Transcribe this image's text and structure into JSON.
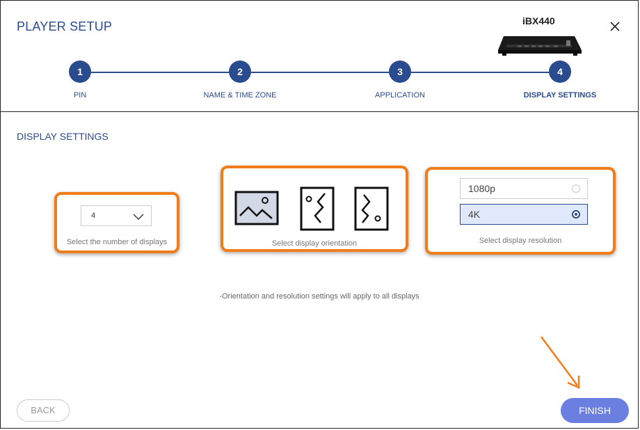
{
  "header": {
    "title": "PLAYER SETUP",
    "device_label": "iBX440",
    "close_icon": "close-icon"
  },
  "steps": [
    {
      "number": "1",
      "label": "PIN"
    },
    {
      "number": "2",
      "label": "NAME & TIME ZONE"
    },
    {
      "number": "3",
      "label": "APPLICATION"
    },
    {
      "number": "4",
      "label": "DISPLAY SETTINGS"
    }
  ],
  "active_step": 4,
  "section": {
    "title": "DISPLAY SETTINGS"
  },
  "displays": {
    "selected_value": "4",
    "caption": "Select the number of displays"
  },
  "orientation": {
    "caption": "Select display orientation",
    "options": [
      "landscape-icon",
      "portrait-icon",
      "portrait-flipped-icon"
    ],
    "selected_index": 0
  },
  "resolution": {
    "caption": "Select display resolution",
    "options": [
      "1080p",
      "4K"
    ],
    "selected": "4K"
  },
  "note": "-Orientation and resolution settings will apply to all displays",
  "footer": {
    "back_label": "BACK",
    "finish_label": "FINISH"
  },
  "colors": {
    "primary": "#2a4b8d",
    "highlight": "#f07c1a",
    "finish_button": "#6b7fe0",
    "selected_bg": "#dfe9fb"
  }
}
